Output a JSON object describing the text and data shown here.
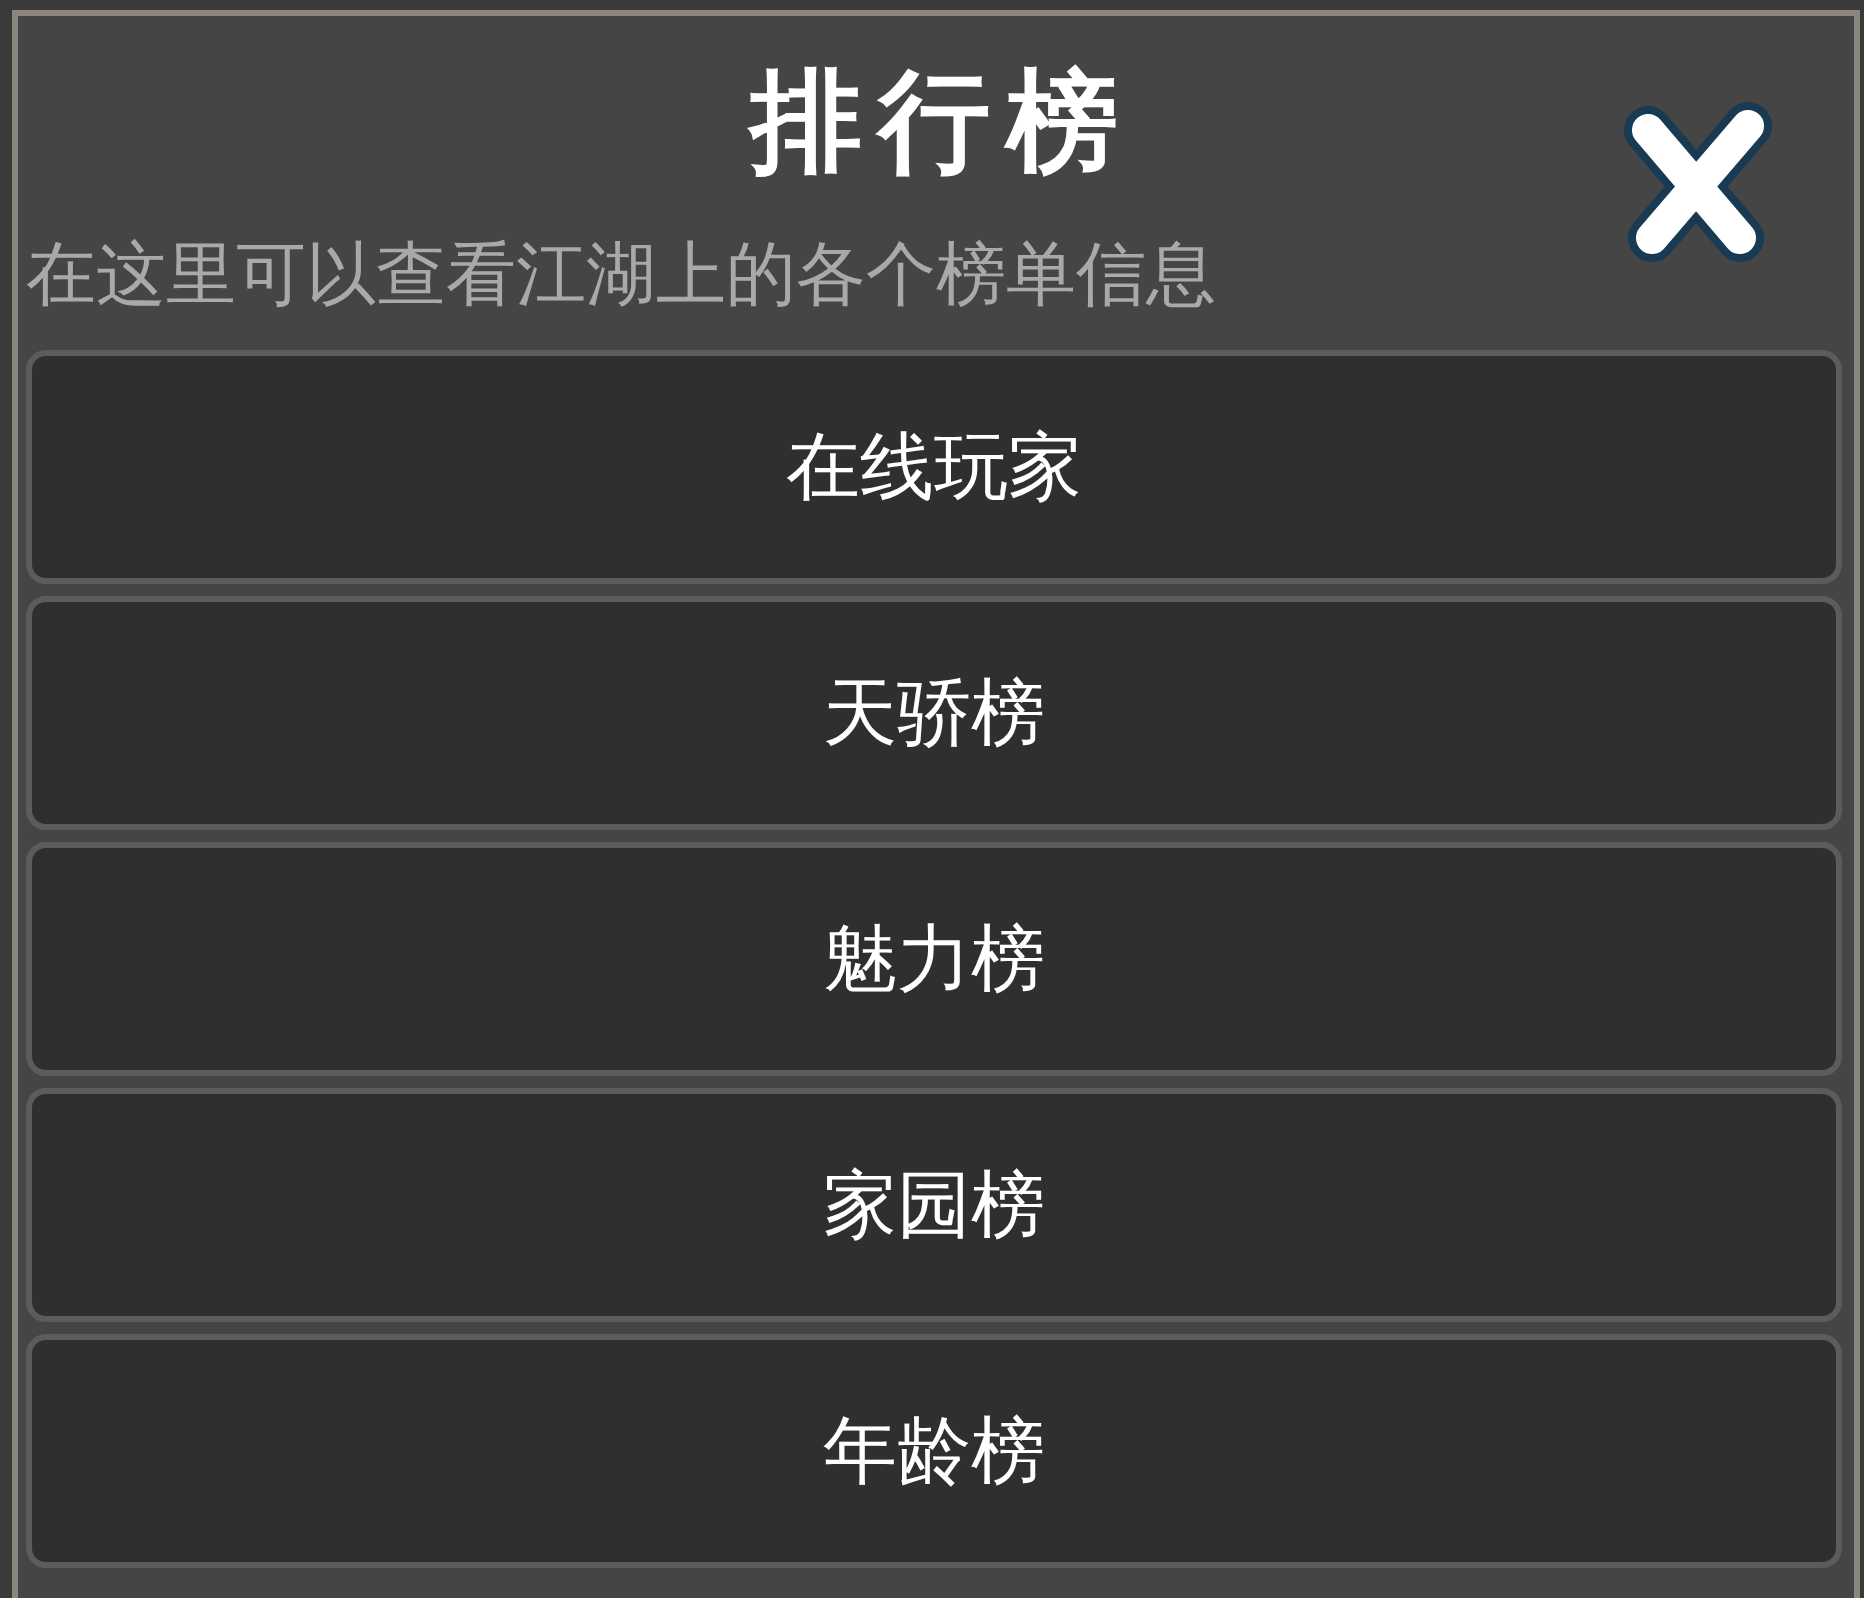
{
  "window": {
    "title": "排行榜",
    "subtitle": "在这里可以查看江湖上的各个榜单信息"
  },
  "menu_items": [
    {
      "label": "在线玩家"
    },
    {
      "label": "天骄榜"
    },
    {
      "label": "魅力榜"
    },
    {
      "label": "家园榜"
    },
    {
      "label": "年龄榜"
    }
  ]
}
